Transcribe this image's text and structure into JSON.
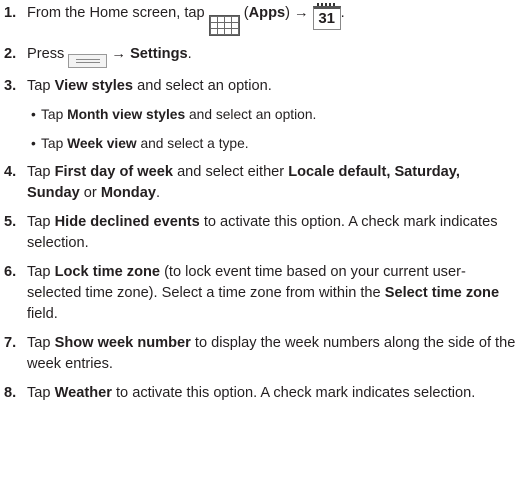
{
  "steps": [
    {
      "num": "1.",
      "pre": "From the Home screen, tap ",
      "paren_open": " (",
      "apps": "Apps",
      "paren_close": ") → ",
      "cal_day": "31",
      "end": "."
    },
    {
      "num": "2.",
      "pre": "Press ",
      "arrow": " → ",
      "settings": "Settings",
      "end": "."
    },
    {
      "num": "3.",
      "pre": "Tap ",
      "b1": "View styles",
      "post": " and select an option."
    },
    {
      "num": "4.",
      "pre": "Tap ",
      "b1": "First day of week",
      "mid1": " and select either ",
      "b2": "Locale default, Saturday,",
      "b3": "Sunday",
      "mid2": " or ",
      "b4": "Monday",
      "end": "."
    },
    {
      "num": "5.",
      "pre": "Tap ",
      "b1": "Hide declined events",
      "post": " to activate this option. A check mark indicates selection."
    },
    {
      "num": "6.",
      "pre": "Tap ",
      "b1": "Lock time zone",
      "post": " (to lock event time based on your current user-selected time zone). Select a time zone from within the ",
      "b2": "Select time zone",
      "end": " field."
    },
    {
      "num": "7.",
      "pre": "Tap ",
      "b1": "Show week number",
      "post": " to display the week numbers along the side of the week entries."
    },
    {
      "num": "8.",
      "pre": "Tap ",
      "b1": "Weather",
      "post": " to activate this option. A check mark indicates selection."
    }
  ],
  "subs": [
    {
      "bullet": "•",
      "pre": "Tap ",
      "b": "Month view styles",
      "post": " and select an option."
    },
    {
      "bullet": "•",
      "pre": "Tap ",
      "b": "Week view",
      "post": " and select a type."
    }
  ],
  "icons": {
    "apps": "apps-grid-icon",
    "calendar": "calendar-icon",
    "menu": "menu-key-icon"
  }
}
